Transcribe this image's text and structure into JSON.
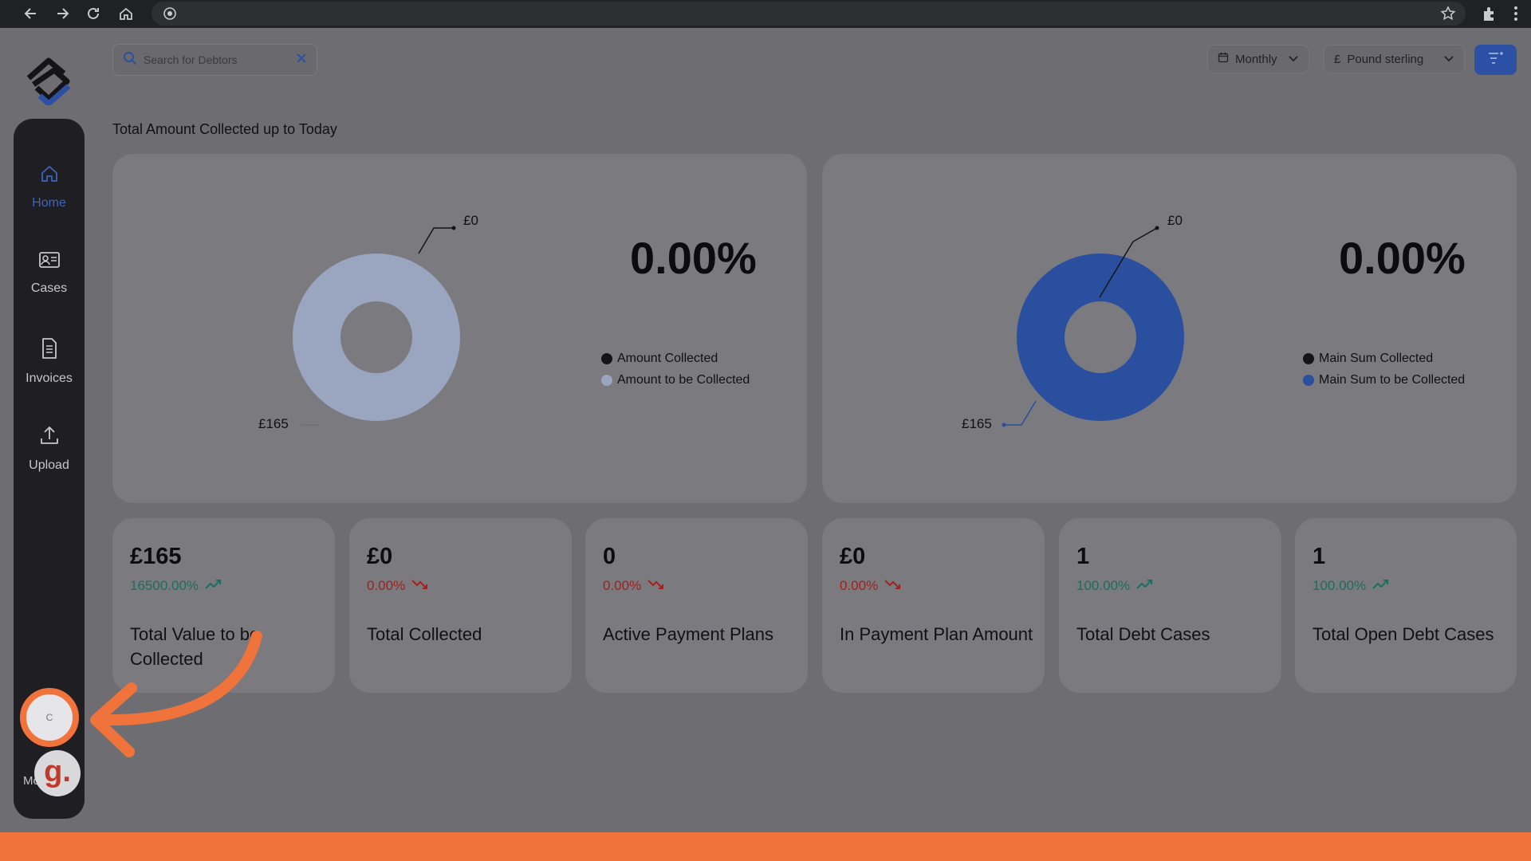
{
  "search": {
    "placeholder": "Search for Debtors"
  },
  "header": {
    "period_label": "Monthly",
    "currency_label": "Pound sterling",
    "currency_symbol": "£"
  },
  "page_title": "Total Amount Collected up to Today",
  "sidebar": {
    "items": [
      {
        "label": "Home",
        "icon": "home-icon",
        "active": true
      },
      {
        "label": "Cases",
        "icon": "id-card-icon",
        "active": false
      },
      {
        "label": "Invoices",
        "icon": "document-icon",
        "active": false
      },
      {
        "label": "Upload",
        "icon": "upload-icon",
        "active": false
      }
    ],
    "avatar_letter": "C",
    "user_label_partial": "Mo",
    "badge_letter": "g."
  },
  "charts": [
    {
      "percent": "0.00%",
      "label_top": "£0",
      "label_bottom": "£165",
      "legend": [
        "Amount Collected",
        "Amount to be Collected"
      ],
      "colors": {
        "collected": "#141416",
        "to_collect": "#9aa5c0"
      }
    },
    {
      "percent": "0.00%",
      "label_top": "£0",
      "label_bottom": "£165",
      "legend": [
        "Main Sum Collected",
        "Main Sum to be Collected"
      ],
      "colors": {
        "collected": "#141416",
        "to_collect": "#2a4f9f"
      }
    }
  ],
  "chart_data": [
    {
      "type": "pie",
      "categories": [
        "Amount Collected",
        "Amount to be Collected"
      ],
      "values": [
        0,
        165
      ],
      "title": "0.00%"
    },
    {
      "type": "pie",
      "categories": [
        "Main Sum Collected",
        "Main Sum to be Collected"
      ],
      "values": [
        0,
        165
      ],
      "title": "0.00%"
    }
  ],
  "stats": [
    {
      "value": "£165",
      "change": "16500.00%",
      "trend": "up",
      "label": "Total Value to be Collected"
    },
    {
      "value": "£0",
      "change": "0.00%",
      "trend": "down",
      "label": "Total Collected"
    },
    {
      "value": "0",
      "change": "0.00%",
      "trend": "down",
      "label": "Active Payment Plans"
    },
    {
      "value": "£0",
      "change": "0.00%",
      "trend": "down",
      "label": "In Payment Plan Amount"
    },
    {
      "value": "1",
      "change": "100.00%",
      "trend": "up",
      "label": "Total Debt Cases"
    },
    {
      "value": "1",
      "change": "100.00%",
      "trend": "up",
      "label": "Total Open Debt Cases"
    }
  ],
  "colors": {
    "accent": "#2c50a3",
    "up": "#1c6c62",
    "down": "#a3201c",
    "annotation": "#f0733b"
  }
}
